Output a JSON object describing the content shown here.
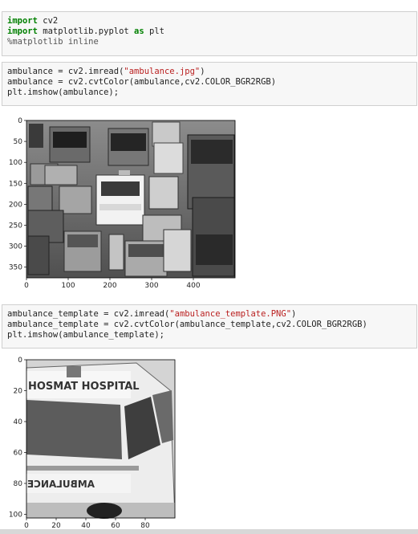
{
  "cells": [
    {
      "lines": [
        {
          "parts": [
            {
              "t": "import",
              "c": "kw"
            },
            {
              "t": " cv2"
            }
          ]
        },
        {
          "parts": [
            {
              "t": "import",
              "c": "kw"
            },
            {
              "t": " matplotlib.pyplot "
            },
            {
              "t": "as",
              "c": "kw"
            },
            {
              "t": " plt"
            }
          ]
        },
        {
          "parts": [
            {
              "t": "%matplotlib inline",
              "c": "magic"
            }
          ]
        }
      ]
    },
    {
      "lines": [
        {
          "parts": [
            {
              "t": "ambulance = cv2.imread("
            },
            {
              "t": "\"ambulance.jpg\"",
              "c": "str"
            },
            {
              "t": ")"
            }
          ]
        },
        {
          "parts": [
            {
              "t": "ambulance = cv2.cvtColor(ambulance,cv2.COLOR_BGR2RGB)"
            }
          ]
        },
        {
          "parts": [
            {
              "t": "plt.imshow(ambulance);"
            }
          ]
        }
      ]
    },
    {
      "lines": [
        {
          "parts": [
            {
              "t": "ambulance_template = cv2.imread("
            },
            {
              "t": "\"ambulance_template.PNG\"",
              "c": "str"
            },
            {
              "t": ")"
            }
          ]
        },
        {
          "parts": [
            {
              "t": "ambulance_template = cv2.cvtColor(ambulance_template,cv2.COLOR_BGR2RGB)"
            }
          ]
        },
        {
          "parts": [
            {
              "t": "plt.imshow(ambulance_template);"
            }
          ]
        }
      ]
    }
  ],
  "plots": [
    {
      "name": "ambulance-plot",
      "image_label": "ambulance.jpg traffic scene",
      "x_ticks": [
        "0",
        "100",
        "200",
        "300",
        "400"
      ],
      "y_ticks": [
        "0",
        "50",
        "100",
        "150",
        "200",
        "250",
        "300",
        "350"
      ]
    },
    {
      "name": "ambulance-template-plot",
      "image_label": "ambulance_template.PNG",
      "sign_text_top": "HOSMAT HOSPITAL",
      "sign_text_bottom": "AMBULANCE",
      "x_ticks": [
        "0",
        "20",
        "40",
        "60",
        "80"
      ],
      "y_ticks": [
        "0",
        "20",
        "40",
        "60",
        "80",
        "100"
      ]
    }
  ]
}
